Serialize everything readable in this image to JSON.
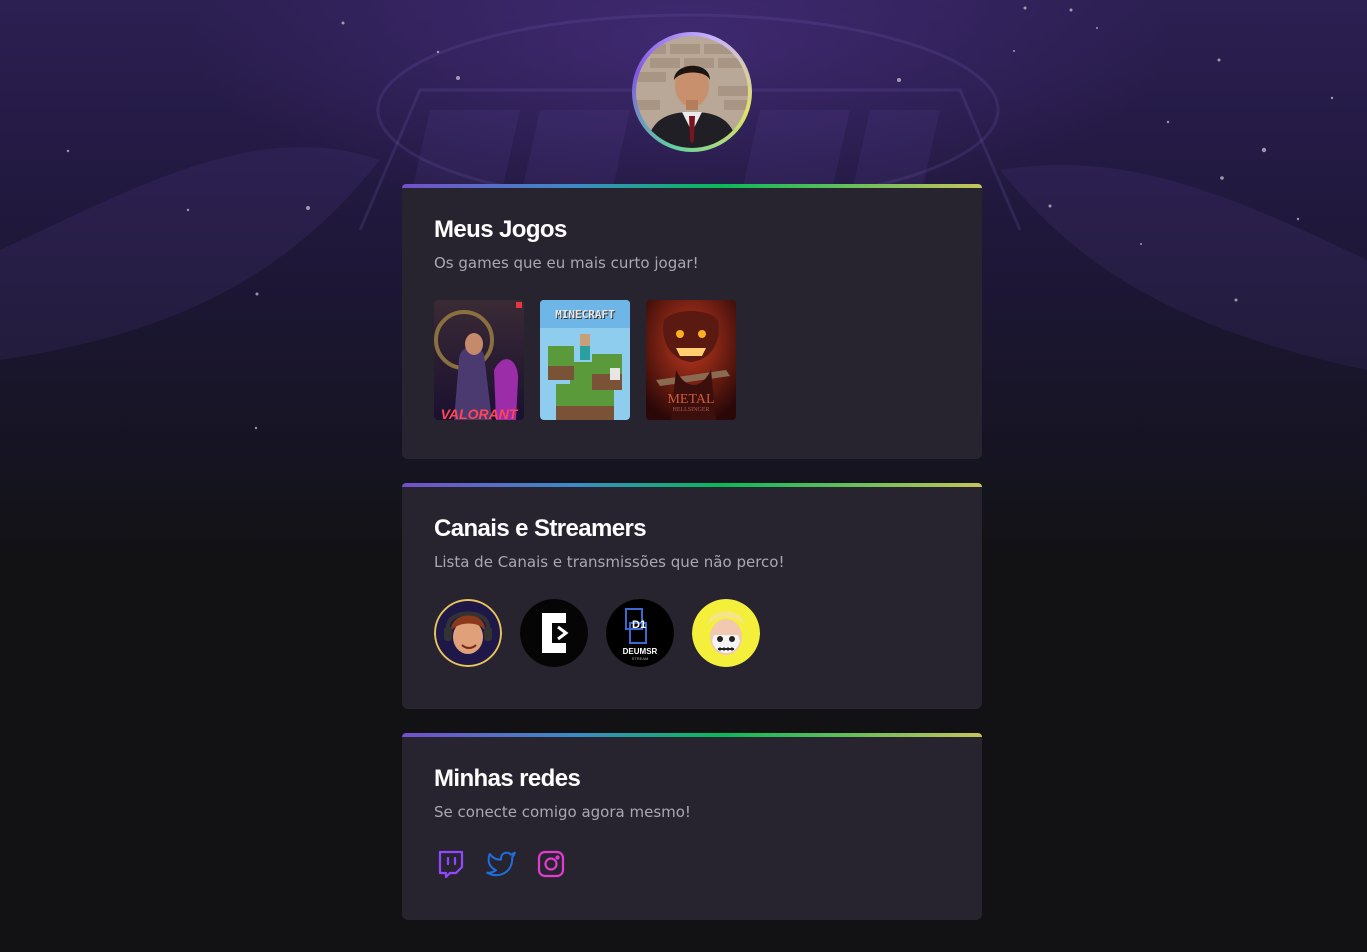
{
  "profile": {
    "avatar": "profile-photo"
  },
  "sections": {
    "games": {
      "title": "Meus Jogos",
      "subtitle": "Os games que eu mais curto jogar!",
      "items": [
        {
          "name": "VALORANT"
        },
        {
          "name": "MINECRAFT"
        },
        {
          "name": "METAL",
          "sub": "HELLSINGER"
        }
      ]
    },
    "streamers": {
      "title": "Canais e Streamers",
      "subtitle": "Lista de Canais e transmissões que não perco!",
      "items": [
        {
          "id": "streamer-1"
        },
        {
          "id": "streamer-2"
        },
        {
          "id": "streamer-3",
          "label": "D1",
          "label2": "DEUMSR",
          "label3": "STREAM"
        },
        {
          "id": "streamer-4"
        }
      ]
    },
    "socials": {
      "title": "Minhas redes",
      "subtitle": "Se conecte comigo agora mesmo!",
      "items": [
        {
          "icon": "twitch-icon",
          "color": "#9147ff"
        },
        {
          "icon": "twitter-icon",
          "color": "#1d6fe0"
        },
        {
          "icon": "instagram-icon",
          "color": "#e13bd0"
        }
      ]
    }
  },
  "colors": {
    "card": "#28242f",
    "background": "#121214",
    "accent": "#8257e5"
  }
}
